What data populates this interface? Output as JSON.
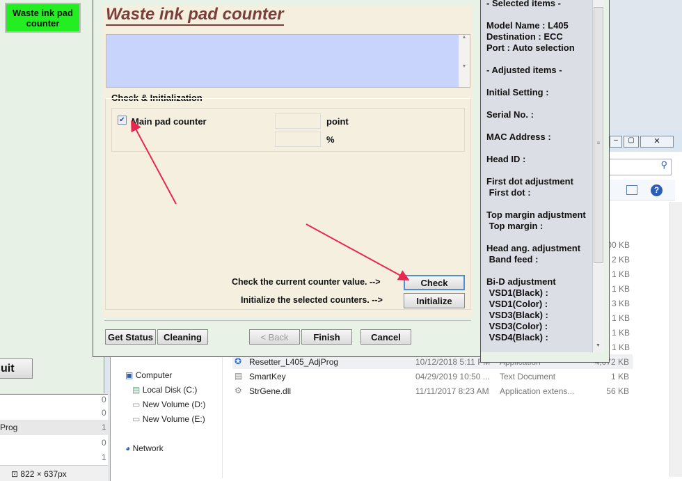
{
  "left_app": {
    "waste_button": "Waste ink pad counter",
    "quit_button": "uit",
    "list_rows": [
      "",
      "",
      "Prog",
      "",
      ""
    ],
    "list_values": [
      "0",
      "0",
      "1",
      "0",
      "1"
    ],
    "status_size": "822 × 637px"
  },
  "dialog": {
    "title": "Waste ink pad counter",
    "group_label": "Check & Initialization",
    "main_pad_label": "Main pad counter",
    "main_pad_checked": true,
    "point_value": "",
    "point_unit": "point",
    "percent_value": "",
    "percent_unit": "%",
    "check_hint": "Check the current counter value. -->",
    "check_button": "Check",
    "init_hint": "Initialize the selected counters. -->",
    "init_button": "Initialize",
    "footer": {
      "get_status": "Get Status",
      "cleaning": "Cleaning",
      "back": "< Back",
      "finish": "Finish",
      "cancel": "Cancel"
    }
  },
  "info_panel": {
    "lines": [
      "- Selected items -",
      "",
      "Model Name : L405",
      "Destination : ECC",
      "Port : Auto selection",
      "",
      "- Adjusted items -",
      "",
      "Initial Setting :",
      "",
      "Serial No. :",
      "",
      "MAC Address :",
      "",
      "Head ID :",
      "",
      "First dot adjustment",
      " First dot :",
      "",
      "Top margin adjustment",
      " Top margin :",
      "",
      "Head ang. adjustment",
      " Band feed :",
      "",
      "Bi-D adjustment",
      " VSD1(Black) :",
      " VSD1(Color) :",
      " VSD3(Black) :",
      " VSD3(Color) :",
      " VSD4(Black) :"
    ]
  },
  "explorer": {
    "nav": [
      "Computer",
      "Local Disk (C:)",
      "New Volume (D:)",
      "New Volume (E:)",
      "Network"
    ],
    "partial_sizes": [
      "00 KB",
      "2 KB",
      "1 KB",
      "1 KB",
      "3 KB",
      "1 KB",
      "1 KB",
      "1 KB"
    ],
    "files": [
      {
        "name": "Resetter_L405_AdjProg",
        "date": "10/12/2018 5:11 PM",
        "type": "Application",
        "size": "4,072 KB"
      },
      {
        "name": "SmartKey",
        "date": "04/29/2019 10:50 ...",
        "type": "Text Document",
        "size": "1 KB"
      },
      {
        "name": "StrGene.dll",
        "date": "11/11/2017 8:23 AM",
        "type": "Application extens...",
        "size": "56 KB"
      }
    ]
  },
  "colors": {
    "accent_green": "#22ee22",
    "title_brown": "#7a3f3a",
    "arrow": "#e8274f",
    "blue_box": "#c8d4fb"
  }
}
